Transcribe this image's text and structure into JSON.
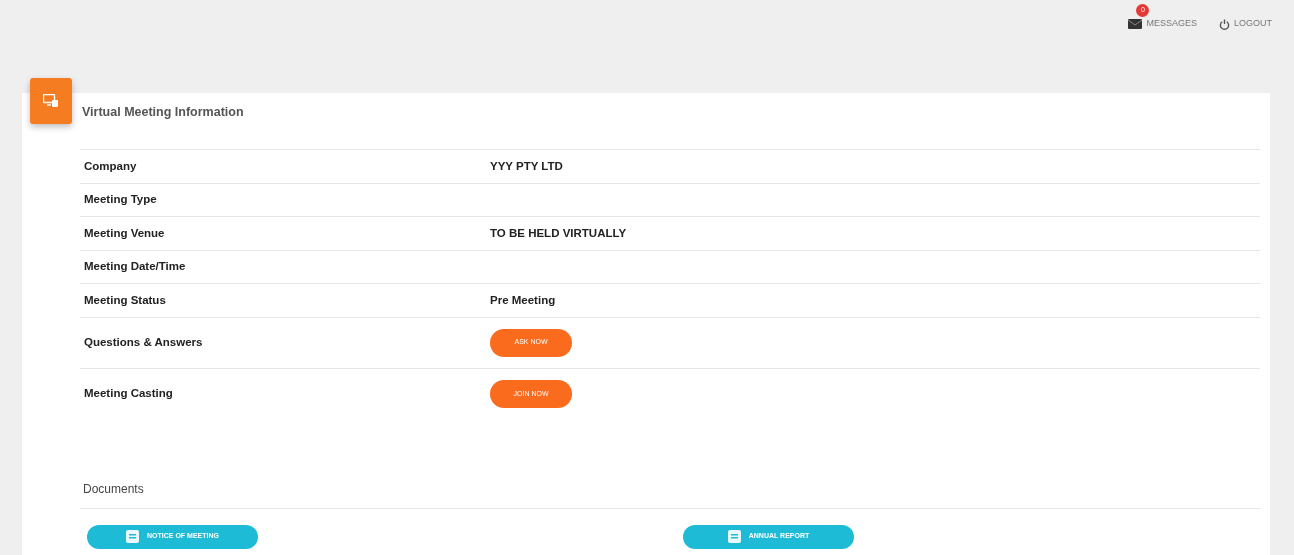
{
  "header": {
    "messages": {
      "label": "MESSAGES",
      "count": "0"
    },
    "logout": {
      "label": "LOGOUT"
    }
  },
  "panel": {
    "title": "Virtual Meeting Information",
    "rows": [
      {
        "label": "Company",
        "kind": "text",
        "value": "YYY PTY LTD"
      },
      {
        "label": "Meeting Type",
        "kind": "text"
      },
      {
        "label": "Meeting Venue",
        "kind": "text",
        "value": "TO BE HELD VIRTUALLY"
      },
      {
        "label": "Meeting Date/Time",
        "kind": "text"
      },
      {
        "label": "Meeting Status",
        "kind": "text",
        "value": "Pre Meeting"
      },
      {
        "label": "Questions & Answers",
        "kind": "button",
        "value": "ASK NOW"
      },
      {
        "label": "Meeting Casting",
        "kind": "button",
        "value": "JOIN NOW"
      }
    ],
    "documents": {
      "title": "Documents",
      "buttons": [
        "NOTICE OF MEETING",
        "ANNUAL REPORT"
      ]
    }
  }
}
